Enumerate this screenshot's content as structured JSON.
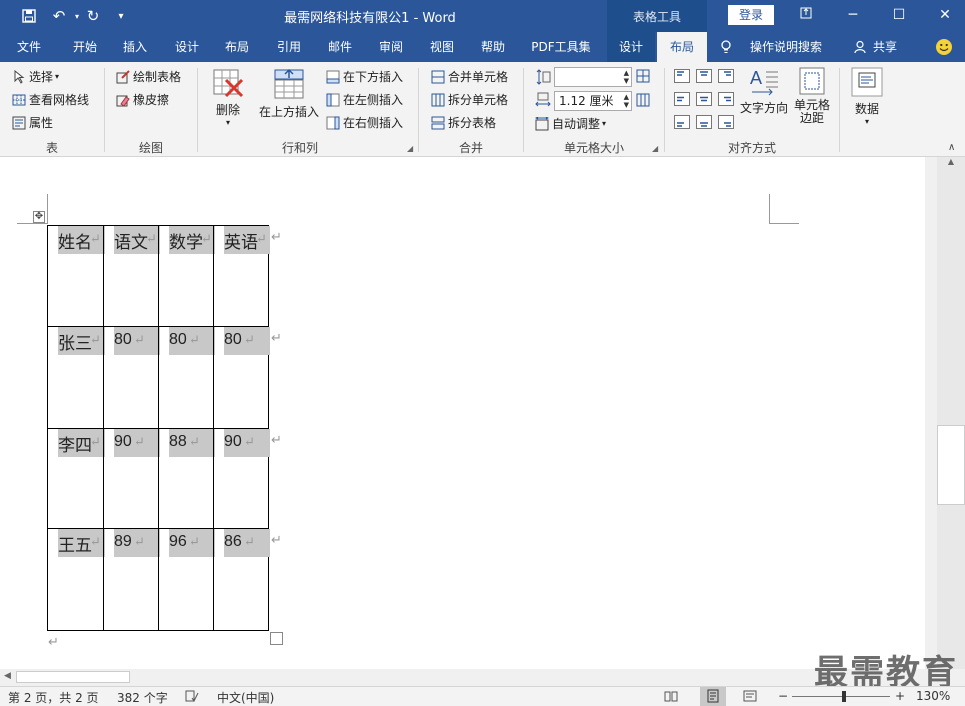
{
  "titlebar": {
    "doc_title": "最需网络科技有限公1  -  Word",
    "context_title": "表格工具",
    "login_label": "登录",
    "icons": [
      "save-icon",
      "undo-icon",
      "redo-icon",
      "customize-qat-icon"
    ],
    "window_controls": [
      "ribbon-display-icon",
      "minimize-icon",
      "maximize-icon",
      "close-icon"
    ]
  },
  "tabs": [
    {
      "label": "文件"
    },
    {
      "label": "开始"
    },
    {
      "label": "插入"
    },
    {
      "label": "设计"
    },
    {
      "label": "布局"
    },
    {
      "label": "引用"
    },
    {
      "label": "邮件"
    },
    {
      "label": "审阅"
    },
    {
      "label": "视图"
    },
    {
      "label": "帮助"
    },
    {
      "label": "PDF工具集"
    },
    {
      "label": "设计"
    },
    {
      "label": "布局"
    }
  ],
  "tellme": {
    "label": "操作说明搜索"
  },
  "share": {
    "label": "共享"
  },
  "ribbon": {
    "table_group": {
      "select": "选择",
      "gridlines": "查看网格线",
      "properties": "属性",
      "label": "表"
    },
    "draw_group": {
      "draw_table": "绘制表格",
      "eraser": "橡皮擦",
      "label": "绘图"
    },
    "rows_cols_group": {
      "delete": "删除",
      "insert_above": "在上方插入",
      "insert_below": "在下方插入",
      "insert_left": "在左侧插入",
      "insert_right": "在右侧插入",
      "label": "行和列"
    },
    "merge_group": {
      "merge_cells": "合并单元格",
      "split_cells": "拆分单元格",
      "split_table": "拆分表格",
      "label": "合并"
    },
    "cell_size_group": {
      "height_value": "",
      "width_value": "1.12 厘米",
      "autofit": "自动调整",
      "label": "单元格大小"
    },
    "align_group": {
      "text_direction": "文字方向",
      "cell_margins_line1": "单元格",
      "cell_margins_line2": "边距",
      "label": "对齐方式"
    },
    "data_group": {
      "label": "数据"
    }
  },
  "table": {
    "rows": [
      [
        "姓名",
        "语文",
        "数学",
        "英语"
      ],
      [
        "张三",
        "80",
        "80",
        "80"
      ],
      [
        "李四",
        "90",
        "88",
        "90"
      ],
      [
        "王五",
        "89",
        "96",
        "86"
      ]
    ],
    "paragraph_mark": "↵",
    "end_mark": "↵"
  },
  "status": {
    "page": "第 2 页，共 2 页",
    "words": "382 个字",
    "language": "中文(中国)",
    "zoom": "130%"
  },
  "watermark": "最需教育",
  "colors": {
    "accent": "#2b579a",
    "ribbon": "#f3f3f3",
    "shade": "#c8c8c8"
  }
}
